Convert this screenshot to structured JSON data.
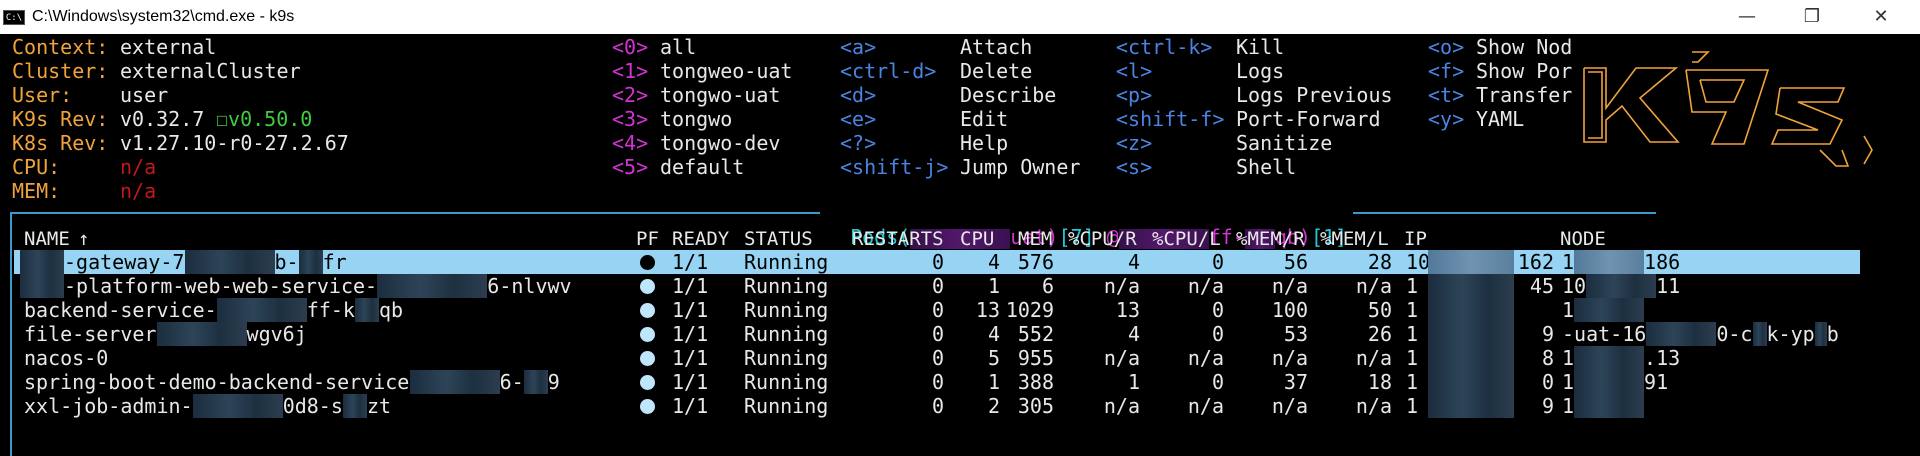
{
  "window": {
    "icon_text": "C:\\",
    "title": "C:\\Windows\\system32\\cmd.exe - k9s",
    "minimize_glyph": "—",
    "maximize_glyph": "❐",
    "close_glyph": "✕"
  },
  "info": [
    {
      "label": "Context:",
      "value": "external"
    },
    {
      "label": "Cluster:",
      "value": "externalCluster"
    },
    {
      "label": "User:",
      "value": "user"
    },
    {
      "label": "K9s Rev:",
      "value": "v0.32.7",
      "extra": "☐v0.50.0"
    },
    {
      "label": "K8s Rev:",
      "value": "v1.27.10-r0-27.2.67"
    },
    {
      "label": "CPU:",
      "value": "n/a"
    },
    {
      "label": "MEM:",
      "value": "n/a"
    }
  ],
  "namespaces": [
    {
      "key": "<0>",
      "name": "all"
    },
    {
      "key": "<1>",
      "name": "tongweo-uat"
    },
    {
      "key": "<2>",
      "name": "tongwo-uat"
    },
    {
      "key": "<3>",
      "name": "tongwo"
    },
    {
      "key": "<4>",
      "name": "tongwo-dev"
    },
    {
      "key": "<5>",
      "name": "default"
    }
  ],
  "shortcuts_a": [
    {
      "key": "<a>",
      "action": "Attach"
    },
    {
      "key": "<ctrl-d>",
      "action": "Delete"
    },
    {
      "key": "<d>",
      "action": "Describe"
    },
    {
      "key": "<e>",
      "action": "Edit"
    },
    {
      "key": "<?>",
      "action": "Help"
    },
    {
      "key": "<shift-j>",
      "action": "Jump Owner"
    }
  ],
  "shortcuts_b": [
    {
      "key": "<ctrl-k>",
      "action": "Kill"
    },
    {
      "key": "<l>",
      "action": "Logs"
    },
    {
      "key": "<p>",
      "action": "Logs Previous"
    },
    {
      "key": "<shift-f>",
      "action": "Port-Forward"
    },
    {
      "key": "<z>",
      "action": "Sanitize"
    },
    {
      "key": "<s>",
      "action": "Shell"
    }
  ],
  "shortcuts_c": [
    {
      "key": "<o>",
      "action": "Show Nod"
    },
    {
      "key": "<f>",
      "action": "Show Por"
    },
    {
      "key": "<t>",
      "action": "Transfer"
    },
    {
      "key": "<y>",
      "action": "YAML"
    }
  ],
  "logo": {
    "lines": [
      " ____  __.________",
      "|    |/ _/   __   \\______",
      "|      < \\____    /  ___/",
      "|    |  \\   /    /\\___ \\",
      "|____|__ \\ /____//____  >",
      "        \\/            \\/"
    ]
  },
  "frame": {
    "resource": "Pods",
    "ns_suffix": "uat)",
    "count": "[7]",
    "filter_prefix": "@",
    "filter_suffix": "ff-",
    "filter_tail": "qb)",
    "filter_count": "[1]"
  },
  "headers": {
    "name": "NAME",
    "sort": "↑",
    "pf": "PF",
    "ready": "READY",
    "status": "STATUS",
    "restarts": "RESTARTS",
    "cpu": "CPU",
    "mem": "MEM",
    "cpu_r": "%CPU/R",
    "cpu_l": "%CPU/L",
    "mem_r": "%MEM/R",
    "mem_l": "%MEM/L",
    "ip": "IP",
    "node": "NODE"
  },
  "pods": [
    {
      "name": "-gateway-7",
      "name_tail": "b-",
      "name_end": "fr",
      "ready": "1/1",
      "status": "Running",
      "restarts": "0",
      "cpu": "4",
      "mem": "576",
      "cpu_r": "4",
      "cpu_l": "0",
      "mem_r": "56",
      "mem_l": "28",
      "ip_head": "10",
      "ip_tail": "162",
      "node_head": "1",
      "node_tail": "186",
      "selected": true
    },
    {
      "name": "-platform-web-web-service-",
      "name_tail": "6-nlvwv",
      "name_end": "",
      "ready": "1/1",
      "status": "Running",
      "restarts": "0",
      "cpu": "1",
      "mem": "6",
      "cpu_r": "n/a",
      "cpu_l": "n/a",
      "mem_r": "n/a",
      "mem_l": "n/a",
      "ip_head": "1",
      "ip_tail": "45",
      "node_head": "10",
      "node_tail": "11",
      "selected": false
    },
    {
      "name": "backend-service-",
      "name_tail": "ff-k",
      "name_end": "qb",
      "ready": "1/1",
      "status": "Running",
      "restarts": "0",
      "cpu": "13",
      "mem": "1029",
      "cpu_r": "13",
      "cpu_l": "0",
      "mem_r": "100",
      "mem_l": "50",
      "ip_head": "1",
      "ip_tail": "",
      "node_head": "1",
      "node_tail": "",
      "selected": false
    },
    {
      "name": "file-server",
      "name_tail": "wgv6j",
      "name_end": "",
      "ready": "1/1",
      "status": "Running",
      "restarts": "0",
      "cpu": "4",
      "mem": "552",
      "cpu_r": "4",
      "cpu_l": "0",
      "mem_r": "53",
      "mem_l": "26",
      "ip_head": "1",
      "ip_tail": "9",
      "node_head": "-uat-16",
      "node_tail": "0-c",
      "node_end": "k-yp",
      "node_last": "b",
      "selected": false
    },
    {
      "name": "nacos-0",
      "name_tail": "",
      "name_end": "",
      "ready": "1/1",
      "status": "Running",
      "restarts": "0",
      "cpu": "5",
      "mem": "955",
      "cpu_r": "n/a",
      "cpu_l": "n/a",
      "mem_r": "n/a",
      "mem_l": "n/a",
      "ip_head": "1",
      "ip_tail": "8",
      "node_head": "1",
      "node_tail": ".13",
      "selected": false
    },
    {
      "name": "spring-boot-demo-backend-service",
      "name_tail": "6-",
      "name_end": "9",
      "ready": "1/1",
      "status": "Running",
      "restarts": "0",
      "cpu": "1",
      "mem": "388",
      "cpu_r": "1",
      "cpu_l": "0",
      "mem_r": "37",
      "mem_l": "18",
      "ip_head": "1",
      "ip_tail": "0",
      "node_head": "1",
      "node_tail": "91",
      "selected": false
    },
    {
      "name": "xxl-job-admin-",
      "name_tail": "0d8-s",
      "name_end": "zt",
      "ready": "1/1",
      "status": "Running",
      "restarts": "0",
      "cpu": "2",
      "mem": "305",
      "cpu_r": "n/a",
      "cpu_l": "n/a",
      "mem_r": "n/a",
      "mem_l": "n/a",
      "ip_head": "1",
      "ip_tail": "9",
      "node_head": "1",
      "node_tail": "",
      "selected": false
    }
  ],
  "colors": {
    "accent": "#f1a33b",
    "selection": "#97d3f2",
    "frame": "#3c9ac8",
    "key": "#4a84e3",
    "namespace_key": "#d333d3"
  }
}
